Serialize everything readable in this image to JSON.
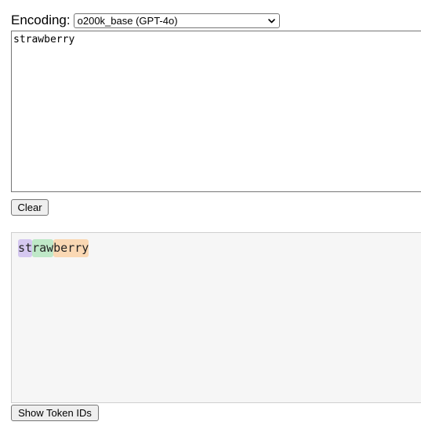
{
  "encoding": {
    "label": "Encoding:",
    "selected": "o200k_base (GPT-4o)"
  },
  "input": {
    "value": "strawberry"
  },
  "buttons": {
    "clear_label": "Clear",
    "show_ids_label": "Show Token IDs"
  },
  "tokens": [
    {
      "text": "st",
      "color": "#d5c8f0"
    },
    {
      "text": "raw",
      "color": "#bfe8c8"
    },
    {
      "text": "berry",
      "color": "#fad8b4"
    }
  ]
}
